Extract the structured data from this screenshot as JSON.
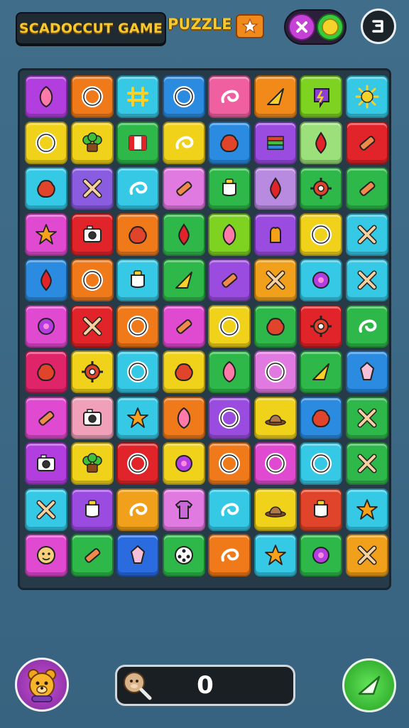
{
  "header": {
    "title": "SCADOCCUT GAME",
    "subtitle": "PUZZLE",
    "star_button_icon": "star-icon",
    "toggle": {
      "left_icon": "close-x-icon",
      "right_icon": "yellow-dot-icon"
    },
    "exit_icon": "exit-icon"
  },
  "colors": {
    "background": "#3d6a86",
    "title_gold": "#f6c92d",
    "board": "#273a47"
  },
  "board": {
    "rows": 11,
    "cols": 8,
    "tiles": [
      [
        {
          "c": "#b23ee0",
          "i": "leaf"
        },
        {
          "c": "#f07a1a",
          "i": "ring"
        },
        {
          "c": "#35c9e6",
          "i": "hash"
        },
        {
          "c": "#2a8be0",
          "i": "ring"
        },
        {
          "c": "#f05fa0",
          "i": "swirl"
        },
        {
          "c": "#f28a1a",
          "i": "cone"
        },
        {
          "c": "#7ed321",
          "i": "bolt"
        },
        {
          "c": "#35c9e6",
          "i": "sun"
        }
      ],
      [
        {
          "c": "#f0d21a",
          "i": "ring"
        },
        {
          "c": "#f0d21a",
          "i": "plant"
        },
        {
          "c": "#2fb84a",
          "i": "flag"
        },
        {
          "c": "#f0d21a",
          "i": "swirl"
        },
        {
          "c": "#2a8be0",
          "i": "blob"
        },
        {
          "c": "#9a4ce0",
          "i": "stack"
        },
        {
          "c": "#9be07a",
          "i": "drop"
        },
        {
          "c": "#e0242a",
          "i": "bar"
        }
      ],
      [
        {
          "c": "#35c9e6",
          "i": "blob"
        },
        {
          "c": "#8a5ce0",
          "i": "cross"
        },
        {
          "c": "#35c9e6",
          "i": "swirl"
        },
        {
          "c": "#e07ae0",
          "i": "bar"
        },
        {
          "c": "#2fb84a",
          "i": "cup"
        },
        {
          "c": "#b88ae0",
          "i": "drop"
        },
        {
          "c": "#2fb84a",
          "i": "gear"
        },
        {
          "c": "#2fb84a",
          "i": "bar"
        }
      ],
      [
        {
          "c": "#e04ad0",
          "i": "star"
        },
        {
          "c": "#e0242a",
          "i": "camera"
        },
        {
          "c": "#f07a1a",
          "i": "blob"
        },
        {
          "c": "#2fb84a",
          "i": "drop"
        },
        {
          "c": "#7ed321",
          "i": "leaf"
        },
        {
          "c": "#9a4ce0",
          "i": "hand"
        },
        {
          "c": "#f0d21a",
          "i": "ring"
        },
        {
          "c": "#35c9e6",
          "i": "cross"
        }
      ],
      [
        {
          "c": "#2a8be0",
          "i": "drop"
        },
        {
          "c": "#f07a1a",
          "i": "ring"
        },
        {
          "c": "#35c9e6",
          "i": "cup"
        },
        {
          "c": "#2fb84a",
          "i": "cone"
        },
        {
          "c": "#9a4ce0",
          "i": "bar"
        },
        {
          "c": "#f0a01a",
          "i": "cross"
        },
        {
          "c": "#35c9e6",
          "i": "dot"
        },
        {
          "c": "#35c9e6",
          "i": "cross"
        }
      ],
      [
        {
          "c": "#e04ad0",
          "i": "dot"
        },
        {
          "c": "#e0242a",
          "i": "cross"
        },
        {
          "c": "#f07a1a",
          "i": "ring"
        },
        {
          "c": "#e04ad0",
          "i": "bar"
        },
        {
          "c": "#f0d21a",
          "i": "ring"
        },
        {
          "c": "#2fb84a",
          "i": "blob"
        },
        {
          "c": "#e0242a",
          "i": "gear"
        },
        {
          "c": "#2fb84a",
          "i": "swirl"
        }
      ],
      [
        {
          "c": "#e0246a",
          "i": "blob"
        },
        {
          "c": "#f0d21a",
          "i": "gear"
        },
        {
          "c": "#35c9e6",
          "i": "ring"
        },
        {
          "c": "#f0d21a",
          "i": "blob"
        },
        {
          "c": "#2fb84a",
          "i": "leaf"
        },
        {
          "c": "#e07ae0",
          "i": "ring"
        },
        {
          "c": "#2fb84a",
          "i": "cone"
        },
        {
          "c": "#2a8be0",
          "i": "gem"
        }
      ],
      [
        {
          "c": "#e04ad0",
          "i": "bar"
        },
        {
          "c": "#f0a0b8",
          "i": "camera"
        },
        {
          "c": "#35c9e6",
          "i": "star"
        },
        {
          "c": "#f07a1a",
          "i": "leaf"
        },
        {
          "c": "#9a4ce0",
          "i": "ring"
        },
        {
          "c": "#f0d21a",
          "i": "hat"
        },
        {
          "c": "#2a8be0",
          "i": "blob"
        },
        {
          "c": "#2fb84a",
          "i": "cross"
        }
      ],
      [
        {
          "c": "#b23ee0",
          "i": "camera"
        },
        {
          "c": "#f0d21a",
          "i": "plant"
        },
        {
          "c": "#e0242a",
          "i": "ring"
        },
        {
          "c": "#f0d21a",
          "i": "dot"
        },
        {
          "c": "#f07a1a",
          "i": "ring"
        },
        {
          "c": "#e04ad0",
          "i": "ring"
        },
        {
          "c": "#35c9e6",
          "i": "ring"
        },
        {
          "c": "#2fb84a",
          "i": "cross"
        }
      ],
      [
        {
          "c": "#35c9e6",
          "i": "cross"
        },
        {
          "c": "#9a4ce0",
          "i": "cup"
        },
        {
          "c": "#f0a01a",
          "i": "swirl"
        },
        {
          "c": "#e07ae0",
          "i": "shirt"
        },
        {
          "c": "#35c9e6",
          "i": "swirl"
        },
        {
          "c": "#f0d21a",
          "i": "hat"
        },
        {
          "c": "#e0442a",
          "i": "cup"
        },
        {
          "c": "#35c9e6",
          "i": "star"
        }
      ],
      [
        {
          "c": "#e04ad0",
          "i": "face"
        },
        {
          "c": "#2fb84a",
          "i": "bar"
        },
        {
          "c": "#2a6be0",
          "i": "gem"
        },
        {
          "c": "#2fb84a",
          "i": "reel"
        },
        {
          "c": "#f07a1a",
          "i": "swirl"
        },
        {
          "c": "#35c9e6",
          "i": "star"
        },
        {
          "c": "#2fb84a",
          "i": "dot"
        },
        {
          "c": "#f0a01a",
          "i": "cross"
        }
      ]
    ]
  },
  "footer": {
    "avatar_icon": "bear-avatar-icon",
    "score_icon": "magnifier-icon",
    "score": "0",
    "play_icon": "play-arrow-icon"
  }
}
